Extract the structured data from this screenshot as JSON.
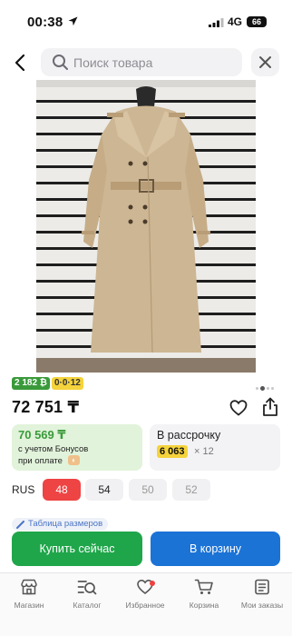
{
  "status_bar": {
    "time": "00:38",
    "network": "4G",
    "battery": "66"
  },
  "search": {
    "placeholder": "Поиск товара",
    "value": ""
  },
  "product": {
    "badge_reviews": "2 182 ₿",
    "badge_timer": "0·0·12",
    "price": "72 751 ₸",
    "image_pages": 4,
    "image_current": 2
  },
  "bonus_card": {
    "amount": "70 569 ₸",
    "line1": "с учетом Бонусов",
    "line2": "при оплате"
  },
  "installment_card": {
    "title": "В рассрочку",
    "monthly": "6 063",
    "multiplier": "× 12"
  },
  "sizes": {
    "label": "RUS",
    "options": [
      "48",
      "54",
      "50",
      "52"
    ],
    "selected": "48"
  },
  "size_table_link": "Таблица размеров",
  "actions": {
    "buy_now": "Купить сейчас",
    "to_cart": "В корзину"
  },
  "tabbar": {
    "items": [
      {
        "label": "Магазин",
        "icon": "store-icon"
      },
      {
        "label": "Каталог",
        "icon": "catalog-search-icon"
      },
      {
        "label": "Избранное",
        "icon": "heart-icon"
      },
      {
        "label": "Корзина",
        "icon": "cart-icon"
      },
      {
        "label": "Мои заказы",
        "icon": "orders-icon"
      }
    ]
  },
  "colors": {
    "green": "#1fa64a",
    "blue": "#1b73d6",
    "selected_size": "#ee4444",
    "badge_yellow": "#f5d33c"
  }
}
